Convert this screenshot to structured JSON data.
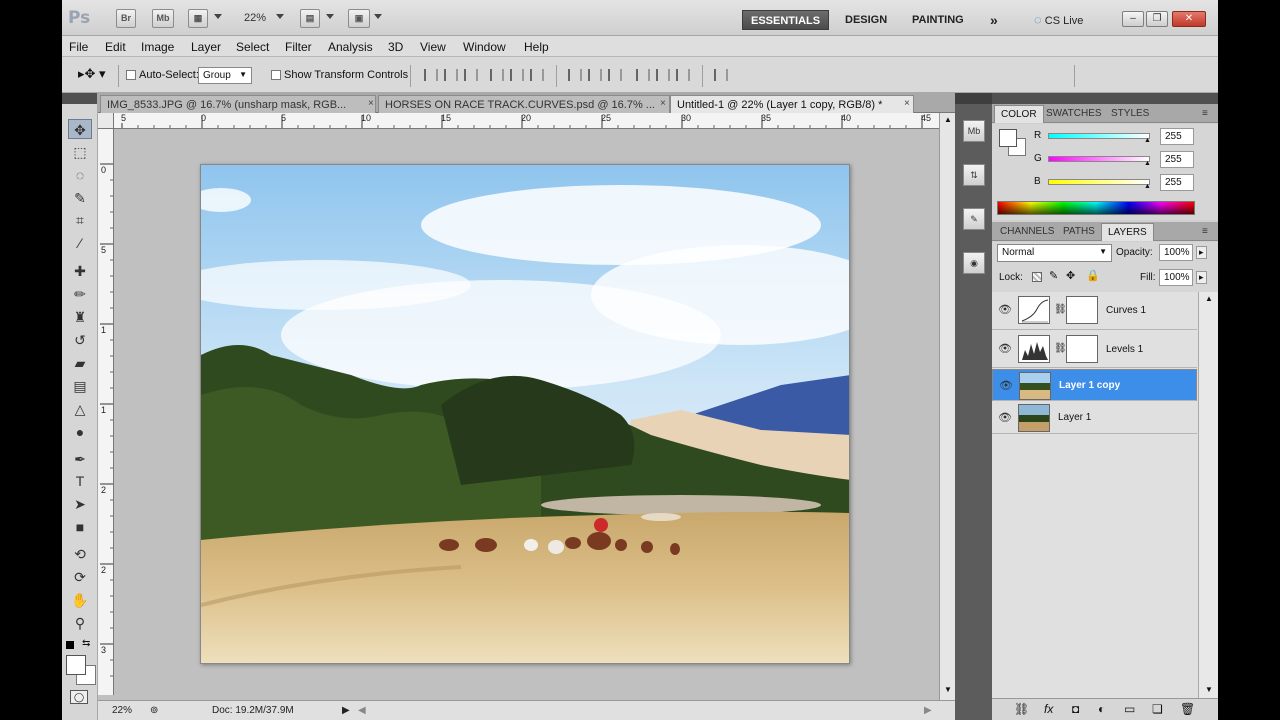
{
  "appbar": {
    "logo": "Ps",
    "bridge_btn": "Br",
    "minibridge_btn": "Mb",
    "zoom": "22%",
    "workspaces": [
      "ESSENTIALS",
      "DESIGN",
      "PAINTING"
    ],
    "more": "»",
    "cslive": "CS Live"
  },
  "menu": [
    "File",
    "Edit",
    "Image",
    "Layer",
    "Select",
    "Filter",
    "Analysis",
    "3D",
    "View",
    "Window",
    "Help"
  ],
  "options": {
    "auto_select_label": "Auto-Select:",
    "auto_select_value": "Group",
    "show_transform_label": "Show Transform Controls"
  },
  "tabs": [
    {
      "label": "IMG_8533.JPG @ 16.7% (unsharp mask, RGB...",
      "close": "×"
    },
    {
      "label": "HORSES ON RACE TRACK.CURVES.psd @ 16.7% ...",
      "close": "×"
    },
    {
      "label": "Untitled-1 @ 22% (Layer 1 copy, RGB/8) *",
      "close": "×"
    }
  ],
  "ruler_h": [
    "5",
    "0",
    "5",
    "10",
    "15",
    "20",
    "25",
    "30",
    "35",
    "40",
    "45"
  ],
  "ruler_v": [
    "0",
    "5",
    "1",
    "1",
    "2",
    "2",
    "3"
  ],
  "status": {
    "zoom": "22%",
    "doc": "Doc: 19.2M/37.9M"
  },
  "color_panel": {
    "tabs": [
      "COLOR",
      "SWATCHES",
      "STYLES"
    ],
    "channels": [
      {
        "label": "R",
        "value": "255",
        "color": "#00e0e0"
      },
      {
        "label": "G",
        "value": "255",
        "color": "#e040e0"
      },
      {
        "label": "B",
        "value": "255",
        "color": "#e8e800"
      }
    ]
  },
  "layers_panel": {
    "tabs": [
      "CHANNELS",
      "PATHS",
      "LAYERS"
    ],
    "blend_mode": "Normal",
    "opacity_label": "Opacity:",
    "opacity": "100%",
    "lock_label": "Lock:",
    "fill_label": "Fill:",
    "fill": "100%",
    "layers": [
      {
        "name": "Curves 1",
        "type": "curves",
        "selected": false
      },
      {
        "name": "Levels 1",
        "type": "levels",
        "selected": false
      },
      {
        "name": "Layer 1 copy",
        "type": "image",
        "selected": true
      },
      {
        "name": "Layer 1",
        "type": "image",
        "selected": false
      }
    ]
  },
  "colors": {
    "accent": "#3c8ee9",
    "workspace_active": "#4b4b4b"
  }
}
